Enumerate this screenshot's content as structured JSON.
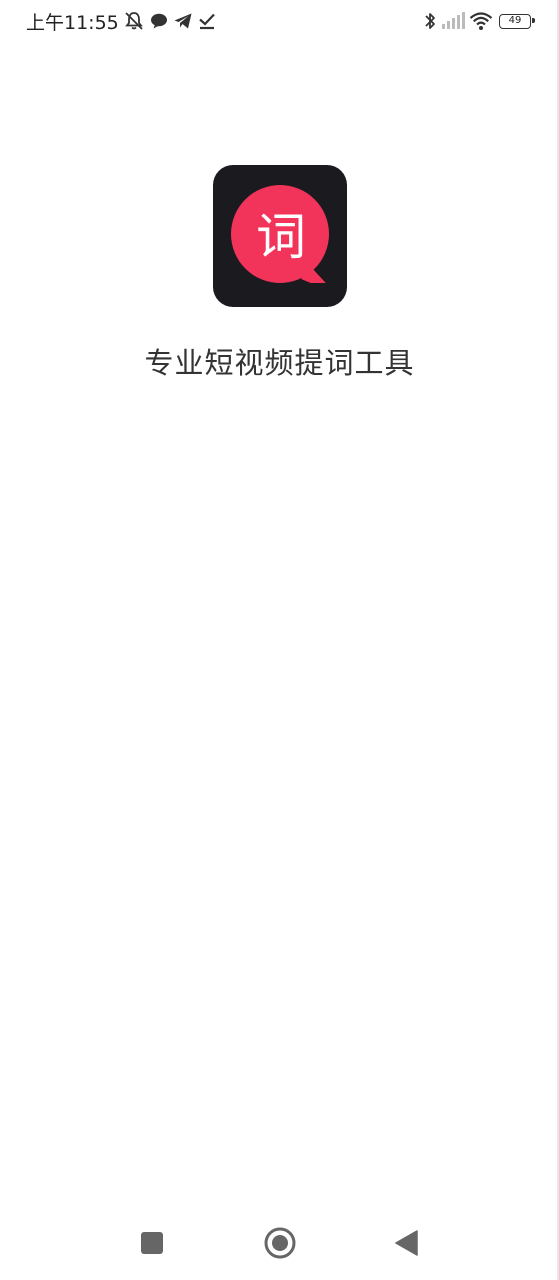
{
  "status_bar": {
    "time": "上午11:55",
    "left_icons": [
      "notifications-off-icon",
      "chat-bubble-icon",
      "telegram-icon",
      "download-done-icon"
    ],
    "right_icons": [
      "bluetooth-icon",
      "signal-icon",
      "wifi-icon"
    ],
    "battery_level": "49"
  },
  "splash": {
    "logo_char": "词",
    "slogan": "专业短视频提词工具",
    "colors": {
      "logo_background": "#1b1a1f",
      "logo_bubble": "#f2345a"
    }
  },
  "nav_bar": {
    "buttons": [
      "recents-button",
      "home-button",
      "back-button"
    ]
  }
}
